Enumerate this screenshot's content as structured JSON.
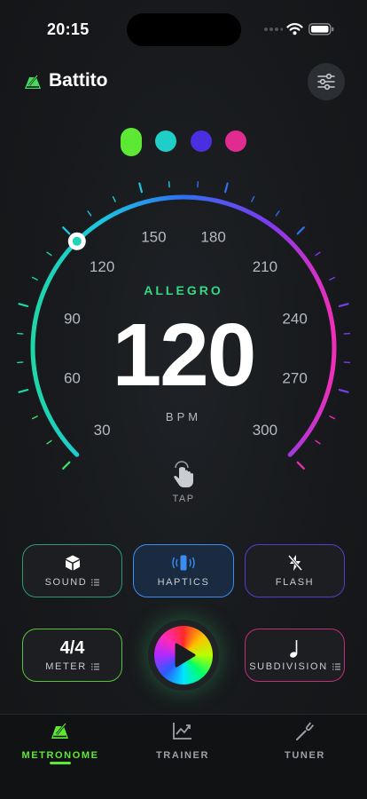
{
  "status_bar": {
    "time": "20:15"
  },
  "app": {
    "title": "Battito"
  },
  "colors": {
    "green": "#5ee836",
    "teal": "#1fcfc7",
    "indigo": "#4a2fe0",
    "magenta": "#e02c91",
    "accent_text": "#35d883"
  },
  "color_dots": [
    {
      "name": "green",
      "selected": true
    },
    {
      "name": "teal",
      "selected": false
    },
    {
      "name": "indigo",
      "selected": false
    },
    {
      "name": "magenta",
      "selected": false
    }
  ],
  "gauge": {
    "min": 30,
    "max": 300,
    "value": 120,
    "tick_labels": [
      "30",
      "60",
      "90",
      "120",
      "150",
      "180",
      "210",
      "240",
      "270",
      "300"
    ]
  },
  "tempo": {
    "marking": "ALLEGRO",
    "bpm": "120",
    "unit": "BPM",
    "tap_label": "TAP"
  },
  "controls": {
    "sound_label": "SOUND",
    "haptics_label": "HAPTICS",
    "flash_label": "FLASH",
    "meter_value": "4/4",
    "meter_label": "METER",
    "subdivision_label": "SUBDIVISION"
  },
  "tabs": [
    {
      "label": "METRONOME",
      "icon": "metronome-icon",
      "active": true
    },
    {
      "label": "TRAINER",
      "icon": "chart-icon",
      "active": false
    },
    {
      "label": "TUNER",
      "icon": "tuning-fork-icon",
      "active": false
    }
  ]
}
